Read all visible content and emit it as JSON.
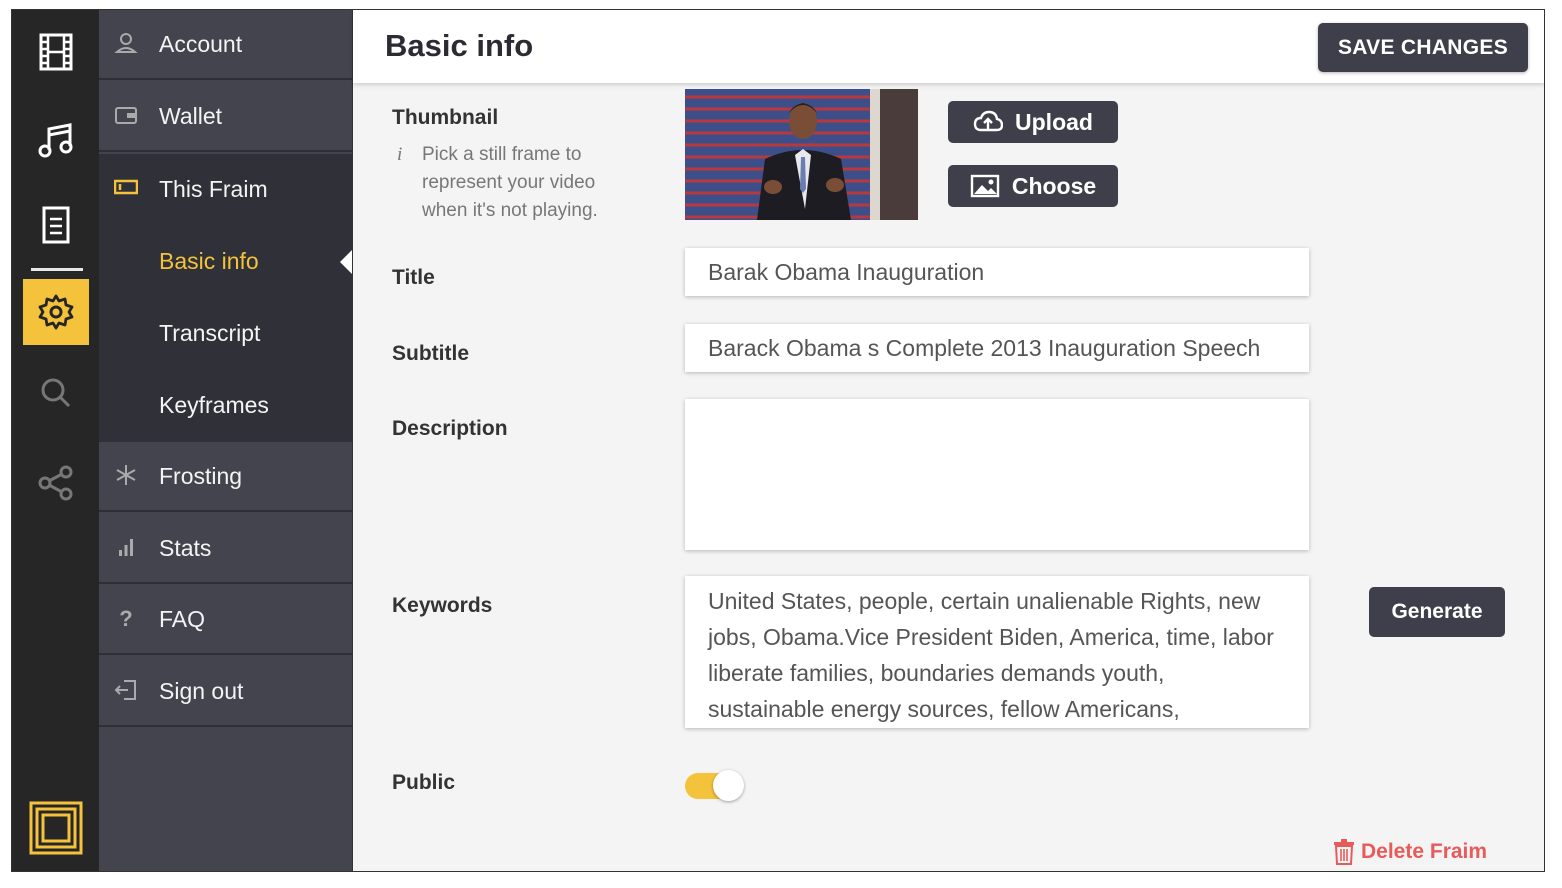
{
  "colors": {
    "accent": "#f5c33b",
    "rail_bg": "#262626",
    "menu_bg": "#44444f",
    "submenu_bg": "#303038",
    "button_bg": "#3e3f4a",
    "danger": "#e85b5b"
  },
  "rail": {
    "icons": [
      "film-icon",
      "music-icon",
      "document-icon",
      "gear-icon",
      "search-icon",
      "share-icon",
      "logo-icon"
    ],
    "active": "gear-icon"
  },
  "menu": {
    "items": [
      {
        "label": "Account",
        "icon": "user-icon"
      },
      {
        "label": "Wallet",
        "icon": "wallet-icon"
      },
      {
        "label": "This Fraim",
        "icon": "frame-icon"
      },
      {
        "label": "Frosting",
        "icon": "asterisk-icon"
      },
      {
        "label": "Stats",
        "icon": "bar-chart-icon"
      },
      {
        "label": "FAQ",
        "icon": "question-icon"
      },
      {
        "label": "Sign out",
        "icon": "sign-out-icon"
      }
    ],
    "subitems": [
      {
        "label": "Basic info",
        "active": true
      },
      {
        "label": "Transcript",
        "active": false
      },
      {
        "label": "Keyframes",
        "active": false
      }
    ]
  },
  "header": {
    "title": "Basic info",
    "save_label": "SAVE CHANGES"
  },
  "thumbnail": {
    "label": "Thumbnail",
    "hint_icon": "i",
    "hint": "Pick a still frame to represent your video when it's not playing.",
    "upload_label": "Upload",
    "choose_label": "Choose"
  },
  "fields": {
    "title_label": "Title",
    "title_value": "Barak Obama Inauguration",
    "subtitle_label": "Subtitle",
    "subtitle_value": "Barack Obama s Complete 2013 Inauguration Speech",
    "description_label": "Description",
    "description_value": "",
    "keywords_label": "Keywords",
    "keywords_value": "United States, people, certain unalienable Rights, new jobs, Obama.Vice President Biden, America, time, labor liberate families, boundaries demands youth, sustainable energy sources, fellow Americans,",
    "generate_label": "Generate",
    "public_label": "Public",
    "public_on": true
  },
  "delete_label": "Delete Fraim"
}
